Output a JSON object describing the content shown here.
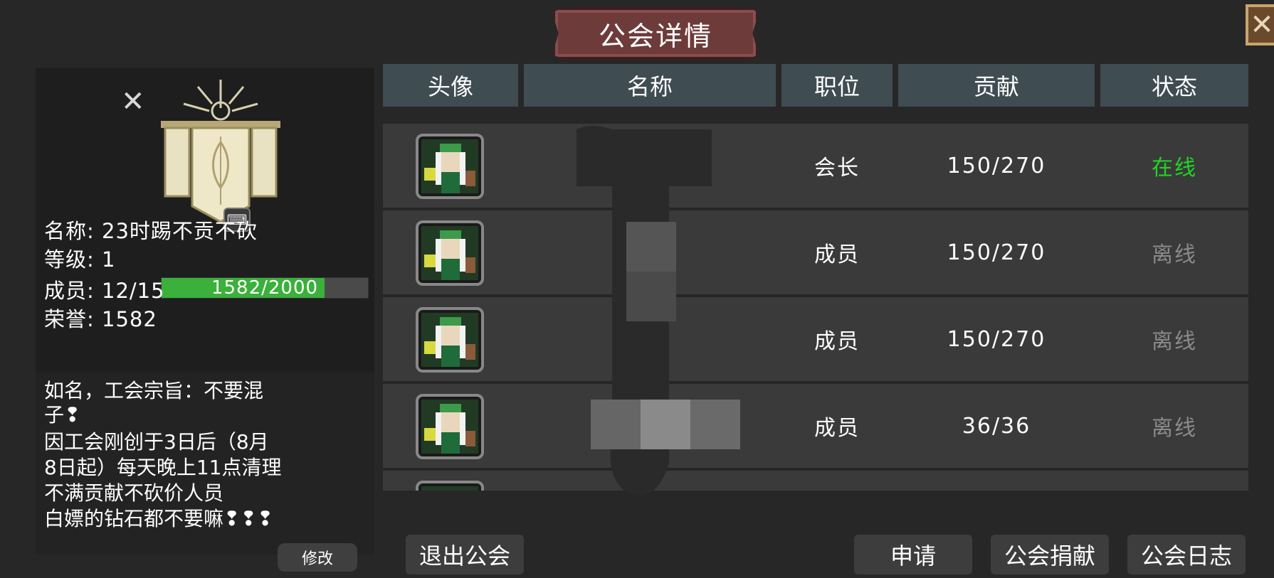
{
  "title": "公会详情",
  "close_icon": "close-x-icon",
  "guild": {
    "name_line": "名称: 23时踢不贡不砍",
    "level_label": "等级: 1",
    "exp_text": "1582/2000",
    "exp_fraction": 0.791,
    "members_line": "成员: 12/15",
    "honor_line": "荣誉: 1582",
    "description_lines": [
      "如名，工会宗旨：不要混",
      "子❢",
      "因工会刚创于3日后（8月",
      "8日起）每天晚上11点清理",
      "不满贡献不砍价人员",
      "白嫖的钻石都不要嘛❢❢❢"
    ],
    "modify_label": "修改"
  },
  "table": {
    "headers": [
      "头像",
      "名称",
      "职位",
      "贡献",
      "状态"
    ],
    "rows": [
      {
        "position": "会长",
        "contribution": "150/270",
        "status": "在线"
      },
      {
        "position": "成员",
        "contribution": "150/270",
        "status": "离线"
      },
      {
        "position": "成员",
        "contribution": "150/270",
        "status": "离线"
      },
      {
        "position": "成员",
        "contribution": "36/36",
        "status": "离线"
      }
    ]
  },
  "buttons": {
    "quit": "退出公会",
    "apply": "申请",
    "donate": "公会捐献",
    "log": "公会日志"
  },
  "colors": {
    "online": "#22d422",
    "offline": "#8a8a8a",
    "header_bg": "#3f4c52",
    "exp_fill": "#3bb03b"
  }
}
